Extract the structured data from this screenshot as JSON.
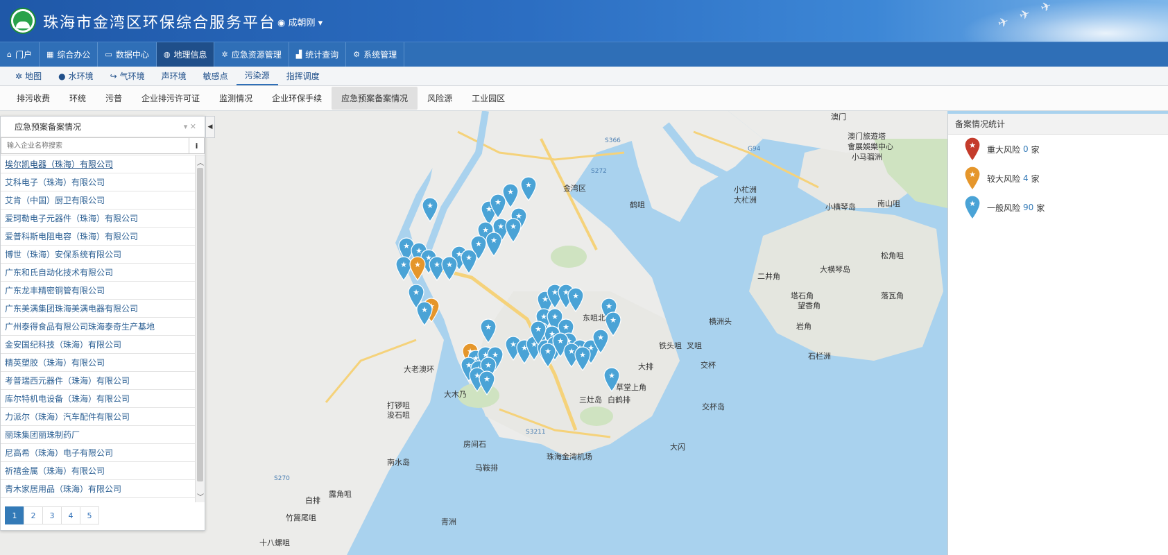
{
  "header": {
    "title": "珠海市金湾区环保综合服务平台",
    "user": "成朝刚"
  },
  "mainnav": [
    {
      "label": "门户",
      "icon": "home-icon",
      "glyph": "⌂"
    },
    {
      "label": "综合办公",
      "icon": "grid-icon",
      "glyph": "▦"
    },
    {
      "label": "数据中心",
      "icon": "monitor-icon",
      "glyph": "▭"
    },
    {
      "label": "地理信息",
      "icon": "globe-icon",
      "glyph": "◍"
    },
    {
      "label": "应急资源管理",
      "icon": "gear-cluster-icon",
      "glyph": "✲"
    },
    {
      "label": "统计查询",
      "icon": "chart-icon",
      "glyph": "▟"
    },
    {
      "label": "系统管理",
      "icon": "gear-icon",
      "glyph": "⚙"
    }
  ],
  "subnav": [
    {
      "label": "地图",
      "glyph": "✲"
    },
    {
      "label": "水环境",
      "glyph": "●"
    },
    {
      "label": "气环境",
      "glyph": "↪"
    },
    {
      "label": "声环境",
      "glyph": ""
    },
    {
      "label": "敏感点",
      "glyph": ""
    },
    {
      "label": "污染源",
      "glyph": ""
    },
    {
      "label": "指挥调度",
      "glyph": ""
    }
  ],
  "tabs": [
    "排污收费",
    "环统",
    "污普",
    "企业排污许可证",
    "监测情况",
    "企业环保手续",
    "应急预案备案情况",
    "风险源",
    "工业园区"
  ],
  "left_panel": {
    "title": "应急预案备案情况",
    "search_placeholder": "输入企业名称搜索",
    "info_label": "i",
    "companies": [
      "埃尔凯电器（珠海）有限公司",
      "艾科电子（珠海）有限公司",
      "艾肯（中国）厨卫有限公司",
      "爱珂勒电子元器件（珠海）有限公司",
      "爱普科斯电阻电容（珠海）有限公司",
      "博世（珠海）安保系统有限公司",
      "广东和氏自动化技术有限公司",
      "广东龙丰精密铜管有限公司",
      "广东美满集团珠海美满电器有限公司",
      "广州泰得食品有限公司珠海泰奇生产基地",
      "金安国纪科技（珠海）有限公司",
      "精英塑胶（珠海）有限公司",
      "考普瑞西元器件（珠海）有限公司",
      "库尔特机电设备（珠海）有限公司",
      "力派尔（珠海）汽车配件有限公司",
      "丽珠集团丽珠制药厂",
      "尼高希（珠海）电子有限公司",
      "祈禧金属（珠海）有限公司",
      "青木家居用品（珠海）有限公司"
    ],
    "pages": [
      "1",
      "2",
      "3",
      "4",
      "5"
    ]
  },
  "right_panel": {
    "title": "备案情况统计",
    "stats": [
      {
        "label": "重大风险",
        "count": "0",
        "unit": "家",
        "color": "#c43b2b"
      },
      {
        "label": "较大风险",
        "count": "4",
        "unit": "家",
        "color": "#e5962b"
      },
      {
        "label": "一般风险",
        "count": "90",
        "unit": "家",
        "color": "#4aa3d6"
      }
    ]
  },
  "map": {
    "labels": [
      {
        "text": "澳门",
        "kind": "big"
      },
      {
        "text": "金湾区",
        "kind": "big"
      },
      {
        "text": "鹤咀",
        "kind": "big"
      },
      {
        "text": "澳门旅遊塔",
        "kind": "big"
      },
      {
        "text": "會展娛樂中心",
        "kind": "big"
      },
      {
        "text": "小马骝洲",
        "kind": "big"
      },
      {
        "text": "小横琴岛",
        "kind": "big"
      },
      {
        "text": "南山咀",
        "kind": "big"
      },
      {
        "text": "小杧洲",
        "kind": "big"
      },
      {
        "text": "大杧洲",
        "kind": "big"
      },
      {
        "text": "松角咀",
        "kind": "big"
      },
      {
        "text": "二井角",
        "kind": "big"
      },
      {
        "text": "大横琴岛",
        "kind": "big"
      },
      {
        "text": "落瓦角",
        "kind": "big"
      },
      {
        "text": "塔石角",
        "kind": "big"
      },
      {
        "text": "望香角",
        "kind": "big"
      },
      {
        "text": "岩角",
        "kind": "big"
      },
      {
        "text": "石栏洲",
        "kind": "big"
      },
      {
        "text": "东咀北",
        "kind": "big"
      },
      {
        "text": "横洲头",
        "kind": "big"
      },
      {
        "text": "铁头咀",
        "kind": "big"
      },
      {
        "text": "叉咀",
        "kind": "big"
      },
      {
        "text": "大排",
        "kind": "big"
      },
      {
        "text": "交杯",
        "kind": "big"
      },
      {
        "text": "三灶岛",
        "kind": "big"
      },
      {
        "text": "白鹤排",
        "kind": "big"
      },
      {
        "text": "草堂上角",
        "kind": "big"
      },
      {
        "text": "交杯岛",
        "kind": "big"
      },
      {
        "text": "大闪",
        "kind": "big"
      },
      {
        "text": "大老澳环",
        "kind": "big"
      },
      {
        "text": "大木乃",
        "kind": "big"
      },
      {
        "text": "打锣咀",
        "kind": "big"
      },
      {
        "text": "浚石咀",
        "kind": "big"
      },
      {
        "text": "房间石",
        "kind": "big"
      },
      {
        "text": "马鞍排",
        "kind": "big"
      },
      {
        "text": "珠海金湾机场",
        "kind": "big"
      },
      {
        "text": "南水岛",
        "kind": "big"
      },
      {
        "text": "露角咀",
        "kind": "big"
      },
      {
        "text": "白排",
        "kind": "big"
      },
      {
        "text": "竹篙尾咀",
        "kind": "big"
      },
      {
        "text": "十八螺咀",
        "kind": "big"
      },
      {
        "text": "青洲",
        "kind": "big"
      },
      {
        "text": "S272",
        "kind": "road"
      },
      {
        "text": "S366",
        "kind": "road"
      },
      {
        "text": "G94",
        "kind": "road"
      },
      {
        "text": "S3211",
        "kind": "road"
      },
      {
        "text": "S270",
        "kind": "road"
      }
    ]
  }
}
